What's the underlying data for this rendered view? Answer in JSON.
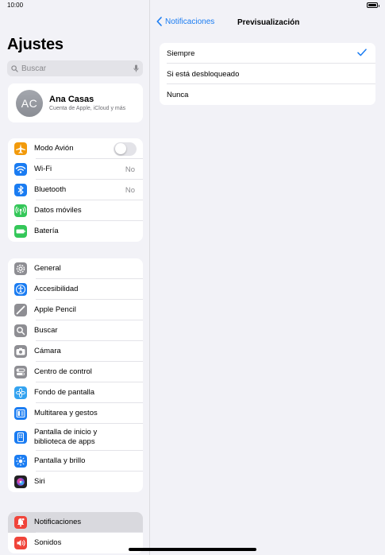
{
  "status": {
    "time": "10:00"
  },
  "sidebar": {
    "title": "Ajustes",
    "search_placeholder": "Buscar",
    "profile": {
      "initials": "AC",
      "name": "Ana Casas",
      "subtitle": "Cuenta de Apple, iCloud y más"
    },
    "group1": [
      {
        "label": "Modo Avión",
        "icon": "airplane-icon",
        "color": "#f29a0b",
        "toggle": "off"
      },
      {
        "label": "Wi-Fi",
        "icon": "wifi-icon",
        "color": "#1a7cf2",
        "value": "No"
      },
      {
        "label": "Bluetooth",
        "icon": "bluetooth-icon",
        "color": "#1a7cf2",
        "value": "No"
      },
      {
        "label": "Datos móviles",
        "icon": "antenna-icon",
        "color": "#34c759"
      },
      {
        "label": "Batería",
        "icon": "battery-icon",
        "color": "#34c759"
      }
    ],
    "group2": [
      {
        "label": "General",
        "icon": "gear-icon",
        "color": "#8e8e93"
      },
      {
        "label": "Accesibilidad",
        "icon": "accessibility-icon",
        "color": "#1a7cf2"
      },
      {
        "label": "Apple Pencil",
        "icon": "pencil-icon",
        "color": "#8e8e93"
      },
      {
        "label": "Buscar",
        "icon": "search-icon",
        "color": "#8e8e93"
      },
      {
        "label": "Cámara",
        "icon": "camera-icon",
        "color": "#8e8e93"
      },
      {
        "label": "Centro de control",
        "icon": "switches-icon",
        "color": "#8e8e93"
      },
      {
        "label": "Fondo de pantalla",
        "icon": "flower-icon",
        "color": "#34a3f0"
      },
      {
        "label": "Multitarea y gestos",
        "icon": "multitask-icon",
        "color": "#1a7cf2"
      },
      {
        "label": "Pantalla de inicio y\nbiblioteca de apps",
        "icon": "home-screen-icon",
        "color": "#1a7cf2"
      },
      {
        "label": "Pantalla y brillo",
        "icon": "sun-icon",
        "color": "#1a7cf2"
      },
      {
        "label": "Siri",
        "icon": "siri-icon",
        "color": "#222222"
      }
    ],
    "group3": [
      {
        "label": "Notificaciones",
        "icon": "bell-icon",
        "color": "#f0443a",
        "selected": true
      },
      {
        "label": "Sonidos",
        "icon": "speaker-icon",
        "color": "#f0443a"
      }
    ]
  },
  "main": {
    "back_label": "Notificaciones",
    "title": "Previsualización",
    "options": [
      {
        "label": "Siempre",
        "checked": true
      },
      {
        "label": "Si está desbloqueado",
        "checked": false
      },
      {
        "label": "Nunca",
        "checked": false
      }
    ],
    "accent": "#1a7cf2"
  }
}
